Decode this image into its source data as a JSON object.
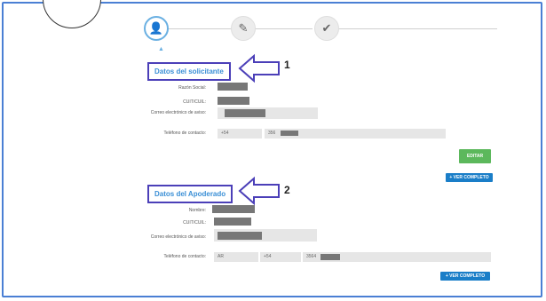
{
  "steps": [
    {
      "name": "user-icon",
      "glyph": "👤"
    },
    {
      "name": "paperclip-icon",
      "glyph": "✎"
    },
    {
      "name": "check-icon",
      "glyph": "✔"
    }
  ],
  "solicitante": {
    "title": "Datos del solicitante",
    "annotation": "1",
    "labels": {
      "razon_social": "Razón Social:",
      "cuit": "CUIT/CUIL:",
      "correo": "Correo electrónico de aviso:",
      "telefono": "Teléfono de contacto:"
    },
    "telefono_prefix": "+54",
    "telefono_area": "356",
    "button_label": "EDITAR"
  },
  "apoderado": {
    "title": "Datos del Apoderado",
    "annotation": "2",
    "labels": {
      "nombre": "Nombre:",
      "cuit": "CUIT/CUIL:",
      "correo": "Correo electrónico de aviso:",
      "telefono": "Teléfono de contacto:"
    },
    "telefono_cod": "AR",
    "telefono_prefix": "+54",
    "telefono_area": "3564"
  },
  "ver_completo_label": "+ VER COMPLETO",
  "colors": {
    "frame": "#4a7fd4",
    "annotation": "#4b3fb8",
    "title": "#3a8fd6",
    "green": "#5cb85c",
    "blue": "#1a7ec8"
  }
}
